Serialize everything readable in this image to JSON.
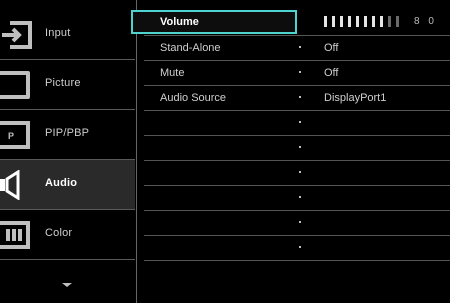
{
  "categories": [
    {
      "label": "Input",
      "icon": "input-icon",
      "active": false
    },
    {
      "label": "Picture",
      "icon": "picture-icon",
      "active": false
    },
    {
      "label": "PIP/PBP",
      "icon": "pip-icon",
      "active": false
    },
    {
      "label": "Audio",
      "icon": "speaker-icon",
      "active": true
    },
    {
      "label": "Color",
      "icon": "color-icon",
      "active": false
    }
  ],
  "settings": [
    {
      "name": "Volume",
      "value": "",
      "selected": true
    },
    {
      "name": "Stand-Alone",
      "value": "Off"
    },
    {
      "name": "Mute",
      "value": "Off"
    },
    {
      "name": "Audio Source",
      "value": "DisplayPort1"
    },
    {
      "name": "",
      "value": ""
    },
    {
      "name": "",
      "value": ""
    },
    {
      "name": "",
      "value": ""
    },
    {
      "name": "",
      "value": ""
    },
    {
      "name": "",
      "value": ""
    },
    {
      "name": "",
      "value": ""
    }
  ],
  "volume": {
    "level": 80,
    "display": "8 0",
    "max": 100
  },
  "colors": {
    "accent": "#4fd3d0",
    "active_bg": "#2a2a2a"
  }
}
